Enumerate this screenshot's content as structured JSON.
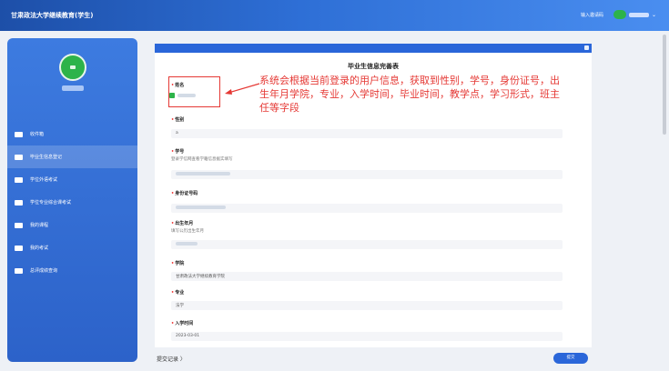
{
  "header": {
    "brand": "甘肃政法大学继续教育(学生)",
    "invite_label": "输入邀请码"
  },
  "sidebar": {
    "items": [
      {
        "label": "收件箱",
        "icon": "inbox-icon"
      },
      {
        "label": "毕业生信息登记",
        "icon": "graduation-icon"
      },
      {
        "label": "学位外语考试",
        "icon": "pen-icon"
      },
      {
        "label": "学位专业综合课考试",
        "icon": "graduation-icon"
      },
      {
        "label": "我的课程",
        "icon": "monitor-icon"
      },
      {
        "label": "我的考试",
        "icon": "document-icon"
      },
      {
        "label": "总评成绩查询",
        "icon": "graduation-icon"
      }
    ]
  },
  "form": {
    "title": "毕业生信息完善表",
    "annotation": "系统会根据当前登录的用户信息，获取到性别，学号，身份证号，出生年月学院，专业，入学时间，毕业时间，教学点，学习形式，班主任等字段",
    "fields": [
      {
        "label": "姓名"
      },
      {
        "label": "性别",
        "value": "a"
      },
      {
        "label": "学号",
        "hint": "登录学信网查看学籍信息据实填写"
      },
      {
        "label": "身份证号码"
      },
      {
        "label": "出生年月",
        "hint": "填写公历出生年月"
      },
      {
        "label": "学院",
        "value": "甘肃政法大学继续教育学院"
      },
      {
        "label": "专业",
        "value": "法学"
      },
      {
        "label": "入学时间",
        "value": "2023-03-01"
      }
    ]
  },
  "footer": {
    "records_label": "提交记录 〉",
    "submit_label": "提交"
  },
  "colors": {
    "accent": "#2a66d9",
    "annotation": "#e53935",
    "avatar": "#2db34a"
  }
}
